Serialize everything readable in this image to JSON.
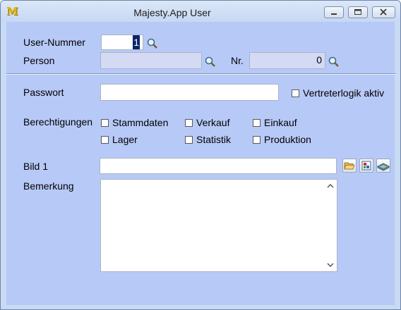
{
  "window": {
    "title": "Majesty.App User",
    "logo": "M",
    "buttons": [
      "minimize-icon",
      "maximize-icon",
      "close-icon"
    ]
  },
  "form": {
    "user_nummer": {
      "label": "User-Nummer",
      "value": "1"
    },
    "person": {
      "label": "Person",
      "value": ""
    },
    "nr": {
      "label": "Nr.",
      "value": "0"
    },
    "passwort": {
      "label": "Passwort",
      "value": ""
    },
    "vertreterlogik": {
      "label": "Vertreterlogik aktiv",
      "checked": false
    },
    "berechtigungen": {
      "label": "Berechtigungen",
      "options": [
        {
          "label": "Stammdaten",
          "checked": false
        },
        {
          "label": "Verkauf",
          "checked": false
        },
        {
          "label": "Einkauf",
          "checked": false
        },
        {
          "label": "Lager",
          "checked": false
        },
        {
          "label": "Statistik",
          "checked": false
        },
        {
          "label": "Produktion",
          "checked": false
        }
      ]
    },
    "bild1": {
      "label": "Bild 1",
      "value": "",
      "tools": [
        "folder-open-icon",
        "image-icon",
        "scanner-icon"
      ]
    },
    "bemerkung": {
      "label": "Bemerkung",
      "value": ""
    }
  },
  "colors": {
    "client_bg": "#b7c9f7",
    "selection": "#0a246a",
    "readonly": "#d4d9f4"
  }
}
